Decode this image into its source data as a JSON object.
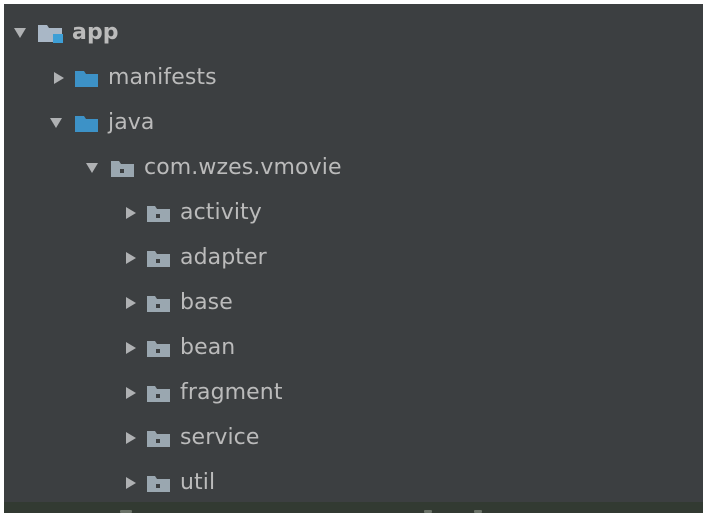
{
  "project_tree": {
    "root": {
      "label": "app",
      "expanded": true,
      "icon": "module-folder-icon"
    },
    "manifests": {
      "label": "manifests",
      "expanded": false,
      "icon": "source-folder-icon"
    },
    "java": {
      "label": "java",
      "expanded": true,
      "icon": "source-folder-icon"
    },
    "package": {
      "label": "com.wzes.vmovie",
      "expanded": true,
      "icon": "package-icon"
    },
    "children": [
      {
        "label": "activity",
        "expanded": false,
        "icon": "package-icon"
      },
      {
        "label": "adapter",
        "expanded": false,
        "icon": "package-icon"
      },
      {
        "label": "base",
        "expanded": false,
        "icon": "package-icon"
      },
      {
        "label": "bean",
        "expanded": false,
        "icon": "package-icon"
      },
      {
        "label": "fragment",
        "expanded": false,
        "icon": "package-icon"
      },
      {
        "label": "service",
        "expanded": false,
        "icon": "package-icon"
      },
      {
        "label": "util",
        "expanded": false,
        "icon": "package-icon"
      }
    ]
  },
  "colors": {
    "panel_background": "#3c3f41",
    "text": "#bbbbbb",
    "arrow": "#afb1b3",
    "module_folder": "#a9b7c6",
    "module_badge": "#3d9fd6",
    "source_folder": "#3d92c7",
    "package_folder": "#9aa7b0"
  }
}
